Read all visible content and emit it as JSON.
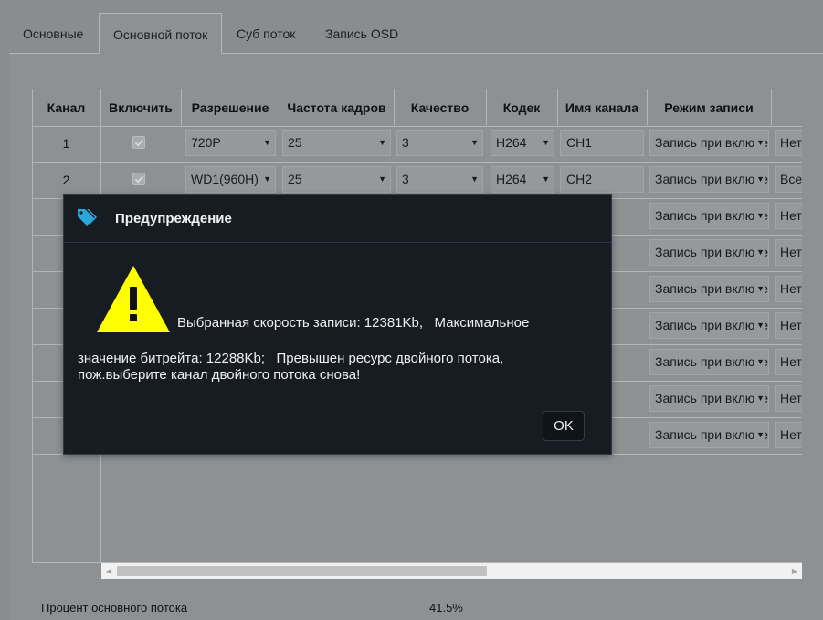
{
  "tabs": [
    {
      "label": "Основные"
    },
    {
      "label": "Основной поток"
    },
    {
      "label": "Суб поток"
    },
    {
      "label": "Запись OSD"
    }
  ],
  "table": {
    "headers": {
      "channel": "Канал",
      "enable": "Включить",
      "resolution": "Разрешение",
      "framerate": "Частота кадров",
      "quality": "Качество",
      "codec": "Кодек",
      "name": "Имя канала",
      "mode": "Режим записи"
    },
    "rows": [
      {
        "channel": "1",
        "resolution": "720P",
        "framerate": "25",
        "quality": "3",
        "codec": "H264",
        "name": "CH1",
        "mode": "Запись при включении",
        "extra": "Нет"
      },
      {
        "channel": "2",
        "resolution": "WD1(960H)",
        "framerate": "25",
        "quality": "3",
        "codec": "H264",
        "name": "CH2",
        "mode": "Запись при включении",
        "extra": "Все"
      },
      {
        "mode": "Запись при включении",
        "extra": "Нет"
      },
      {
        "mode": "Запись при включении",
        "extra": "Нет"
      },
      {
        "mode": "Запись при включении",
        "extra": "Нет"
      },
      {
        "mode": "Запись при включении",
        "extra": "Нет"
      },
      {
        "mode": "Запись при включении",
        "extra": "Нет"
      },
      {
        "mode": "Запись при включении",
        "extra": "Нет"
      },
      {
        "mode": "Запись при включении",
        "extra": "Нет"
      }
    ]
  },
  "footer": {
    "label": "Процент основного потока",
    "value": "41.5%"
  },
  "dialog": {
    "title": "Предупреждение",
    "line1": "Выбранная скорость записи: 12381Kb,   Максимальное",
    "line2": "значение битрейта: 12288Kb;   Превышен ресурс двойного потока,",
    "line3": "пож.выберите канал двойного потока снова!",
    "ok": "OK"
  },
  "colors": {
    "page_bg": "#8a8d8f",
    "dialog_bg": "#161c22",
    "warning_yellow": "#ffff00",
    "tag_icon": "#2aa7dd"
  }
}
